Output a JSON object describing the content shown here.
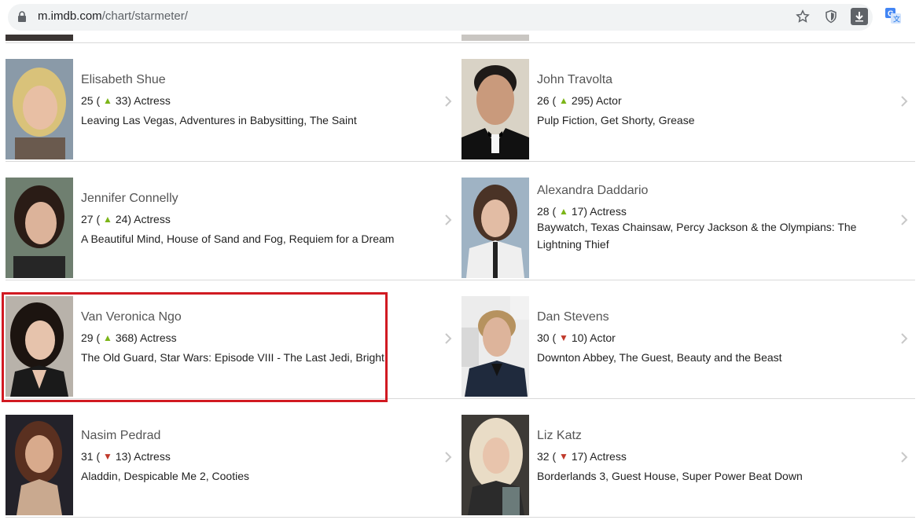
{
  "browser": {
    "url_host": "m.imdb.com",
    "url_path": "/chart/starmeter/"
  },
  "colors": {
    "up": "#7cb518",
    "down": "#c0392b",
    "highlight": "#d11a22"
  },
  "icons": {
    "lock": "lock-icon",
    "bookmark": "star-icon",
    "shield": "shield-icon",
    "download": "download-icon",
    "translate": "translate-icon",
    "chevron": "chevron-right-icon",
    "trend_up": "arrow-up-icon",
    "trend_down": "arrow-down-icon"
  },
  "stars": [
    {
      "name": "Elisabeth Shue",
      "rank": "25",
      "change": "33",
      "trend": "up",
      "role": "Actress",
      "films": "Leaving Las Vegas, Adventures in Babysitting, The Saint"
    },
    {
      "name": "John Travolta",
      "rank": "26",
      "change": "295",
      "trend": "up",
      "role": "Actor",
      "films": "Pulp Fiction, Get Shorty, Grease"
    },
    {
      "name": "Jennifer Connelly",
      "rank": "27",
      "change": "24",
      "trend": "up",
      "role": "Actress",
      "films": "A Beautiful Mind, House of Sand and Fog, Requiem for a Dream"
    },
    {
      "name": "Alexandra Daddario",
      "rank": "28",
      "change": "17",
      "trend": "up",
      "role": "Actress",
      "films": "Baywatch, Texas Chainsaw, Percy Jackson & the Olympians: The Lightning Thief"
    },
    {
      "name": "Van Veronica Ngo",
      "rank": "29",
      "change": "368",
      "trend": "up",
      "role": "Actress",
      "films": "The Old Guard, Star Wars: Episode VIII - The Last Jedi, Bright"
    },
    {
      "name": "Dan Stevens",
      "rank": "30",
      "change": "10",
      "trend": "down",
      "role": "Actor",
      "films": "Downton Abbey, The Guest, Beauty and the Beast"
    },
    {
      "name": "Nasim Pedrad",
      "rank": "31",
      "change": "13",
      "trend": "down",
      "role": "Actress",
      "films": "Aladdin, Despicable Me 2, Cooties"
    },
    {
      "name": "Liz Katz",
      "rank": "32",
      "change": "17",
      "trend": "down",
      "role": "Actress",
      "films": "Borderlands 3, Guest House, Super Power Beat Down"
    }
  ]
}
